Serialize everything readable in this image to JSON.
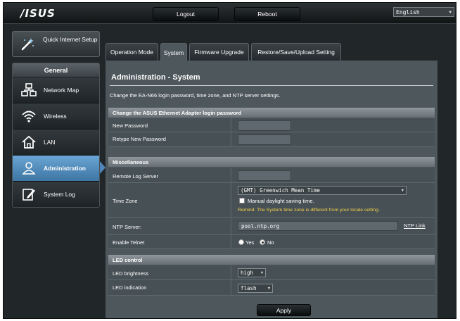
{
  "header": {
    "logo": "/ISUS",
    "logout_label": "Logout",
    "reboot_label": "Reboot",
    "language": "English"
  },
  "sidebar": {
    "qis_label": "Quick Internet Setup",
    "general_label": "General",
    "items": [
      {
        "label": "Network Map",
        "icon": "network-map-icon"
      },
      {
        "label": "Wireless",
        "icon": "wireless-icon"
      },
      {
        "label": "LAN",
        "icon": "home-icon"
      },
      {
        "label": "Administration",
        "icon": "user-icon",
        "active": true
      },
      {
        "label": "System Log",
        "icon": "log-icon"
      }
    ]
  },
  "tabs": [
    {
      "label": "Operation Mode"
    },
    {
      "label": "System",
      "active": true
    },
    {
      "label": "Firmware Upgrade"
    },
    {
      "label": "Restore/Save/Upload Setting"
    }
  ],
  "main": {
    "title": "Administration - System",
    "description": "Change the EA-N66 login password, time zone, and NTP server settings.",
    "section_password": {
      "title": "Change the ASUS Ethernet Adapter login password",
      "new_password_label": "New Password",
      "retype_label": "Retype New Password"
    },
    "section_misc": {
      "title": "Miscellaneous",
      "remote_log_label": "Remote Log Server",
      "time_zone_label": "Time Zone",
      "time_zone_value": "(GMT) Greenwich Mean Time",
      "dst_label": "Manual daylight saving time.",
      "remind": "Remind: The System time zone is different from your locale setting.",
      "ntp_label": "NTP Server:",
      "ntp_value": "pool.ntp.org",
      "ntp_link": "NTP Link",
      "telnet_label": "Enable Telnet",
      "telnet_yes": "Yes",
      "telnet_no": "No",
      "telnet_selected": "No"
    },
    "section_led": {
      "title": "LED control",
      "brightness_label": "LED brightness",
      "brightness_value": "high",
      "indication_label": "LED indication",
      "indication_value": "flash"
    },
    "apply_label": "Apply"
  },
  "colors": {
    "background": "#212628",
    "panel": "#4e575c",
    "active_menu": "#5a93c4",
    "remind_text": "#f5d24a"
  }
}
